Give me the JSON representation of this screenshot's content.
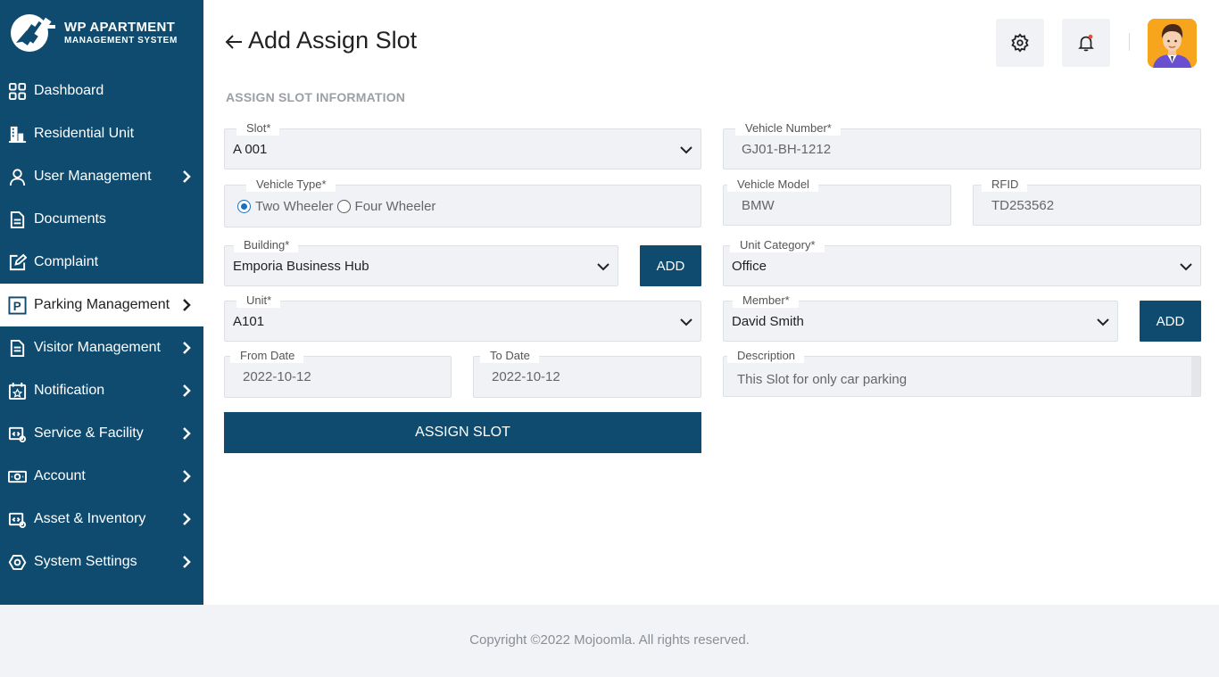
{
  "brand": {
    "title": "WP APARTMENT",
    "subtitle": "MANAGEMENT SYSTEM"
  },
  "sidebar": {
    "items": [
      {
        "label": "Dashboard",
        "icon": "grid-icon",
        "has_submenu": false
      },
      {
        "label": "Residential Unit",
        "icon": "building-icon",
        "has_submenu": false
      },
      {
        "label": "User Management",
        "icon": "user-icon",
        "has_submenu": true
      },
      {
        "label": "Documents",
        "icon": "document-icon",
        "has_submenu": false
      },
      {
        "label": "Complaint",
        "icon": "edit-icon",
        "has_submenu": false
      },
      {
        "label": "Parking Management",
        "icon": "parking-icon",
        "has_submenu": true,
        "active": true
      },
      {
        "label": "Visitor Management",
        "icon": "clipboard-icon",
        "has_submenu": true
      },
      {
        "label": "Notification",
        "icon": "calendar-star-icon",
        "has_submenu": true
      },
      {
        "label": "Service & Facility",
        "icon": "service-icon",
        "has_submenu": true
      },
      {
        "label": "Account",
        "icon": "money-icon",
        "has_submenu": true
      },
      {
        "label": "Asset & Inventory",
        "icon": "inventory-icon",
        "has_submenu": true
      },
      {
        "label": "System Settings",
        "icon": "settings-hex-icon",
        "has_submenu": true
      }
    ]
  },
  "header": {
    "title": "Add Assign Slot",
    "settings_icon": "gear-icon",
    "notification_icon": "bell-icon",
    "notification_dot_color": "#e74c3c"
  },
  "form": {
    "section_title": "ASSIGN SLOT INFORMATION",
    "slot": {
      "label": "Slot*",
      "value": "A 001"
    },
    "vehicle_number": {
      "label": "Vehicle Number*",
      "value": "GJ01-BH-1212"
    },
    "vehicle_type": {
      "label": "Vehicle Type*",
      "options": [
        "Two Wheeler",
        "Four Wheeler"
      ],
      "selected": "Two Wheeler"
    },
    "vehicle_model": {
      "label": "Vehicle Model",
      "value": "BMW"
    },
    "rfid": {
      "label": "RFID",
      "value": "TD253562"
    },
    "building": {
      "label": "Building*",
      "value": "Emporia Business Hub"
    },
    "building_add": "ADD",
    "unit_category": {
      "label": "Unit Category*",
      "value": "Office"
    },
    "unit": {
      "label": "Unit*",
      "value": "A101"
    },
    "member": {
      "label": "Member*",
      "value": "David Smith"
    },
    "member_add": "ADD",
    "from_date": {
      "label": "From Date",
      "value": "2022-10-12"
    },
    "to_date": {
      "label": "To Date",
      "value": "2022-10-12"
    },
    "description": {
      "label": "Description",
      "value": "This Slot for only car parking"
    },
    "submit": "ASSIGN SLOT"
  },
  "footer": {
    "copyright": "Copyright ©2022 Mojoomla. All rights reserved."
  },
  "colors": {
    "primary": "#0f4b6e",
    "field_bg": "#f0f2f6",
    "radio_selected": "#1f6fb8",
    "avatar_bg": "#f7a51c"
  }
}
